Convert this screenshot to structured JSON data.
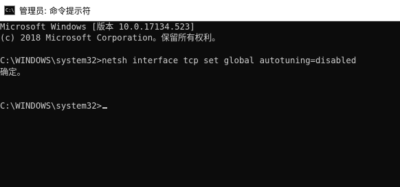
{
  "window": {
    "title": "管理员: 命令提示符",
    "icon_text": "C:\\."
  },
  "console": {
    "lines": [
      "Microsoft Windows [版本 10.0.17134.523]",
      "(c) 2018 Microsoft Corporation。保留所有权利。",
      "",
      "C:\\WINDOWS\\system32>netsh interface tcp set global autotuning=disabled",
      "确定。",
      "",
      "",
      "C:\\WINDOWS\\system32>"
    ]
  },
  "colors": {
    "console_bg": "#0c0c0c",
    "console_text": "#cccccc",
    "titlebar_bg": "#ffffff"
  }
}
